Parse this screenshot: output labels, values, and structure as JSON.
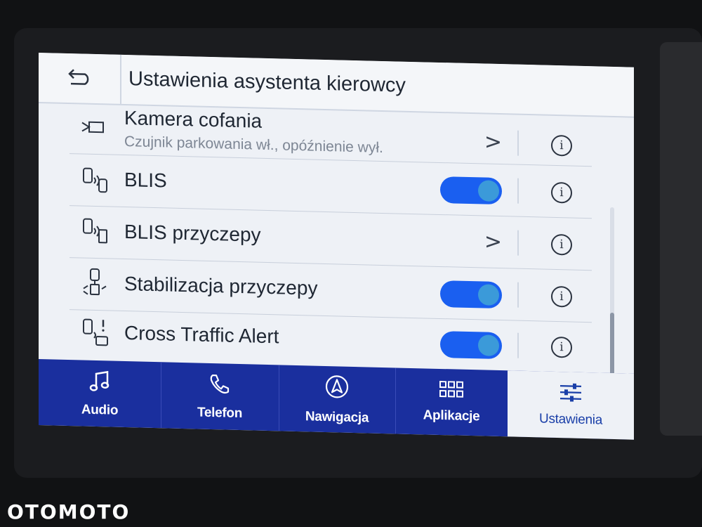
{
  "header": {
    "title": "Ustawienia asystenta kierowcy"
  },
  "rows": [
    {
      "label": "Kamera cofania",
      "subtitle": "Czujnik parkowania wł., opóźnienie wył.",
      "control": "chevron",
      "chevron": ">",
      "info": "i",
      "icon": "camera-icon"
    },
    {
      "label": "BLIS",
      "control": "toggle",
      "toggle_on": true,
      "info": "i",
      "icon": "blind-spot-icon"
    },
    {
      "label": "BLIS przyczepy",
      "control": "chevron",
      "chevron": ">",
      "info": "i",
      "icon": "trailer-blind-spot-icon"
    },
    {
      "label": "Stabilizacja przyczepy",
      "control": "toggle",
      "toggle_on": true,
      "info": "i",
      "icon": "trailer-sway-icon"
    },
    {
      "label": "Cross Traffic Alert",
      "control": "toggle",
      "toggle_on": true,
      "info": "i",
      "icon": "cross-traffic-icon"
    }
  ],
  "tabs": [
    {
      "label": "Audio",
      "icon": "music-note-icon",
      "active": false
    },
    {
      "label": "Telefon",
      "icon": "phone-icon",
      "active": false
    },
    {
      "label": "Nawigacja",
      "icon": "navigation-icon",
      "active": false
    },
    {
      "label": "Aplikacje",
      "icon": "apps-grid-icon",
      "active": false
    },
    {
      "label": "Ustawienia",
      "icon": "sliders-icon",
      "active": true
    }
  ],
  "watermark": "OTOMOTO",
  "colors": {
    "accent": "#1a5ff0",
    "tabbar": "#1a2f9e",
    "active_tab_text": "#1a3fa8"
  }
}
